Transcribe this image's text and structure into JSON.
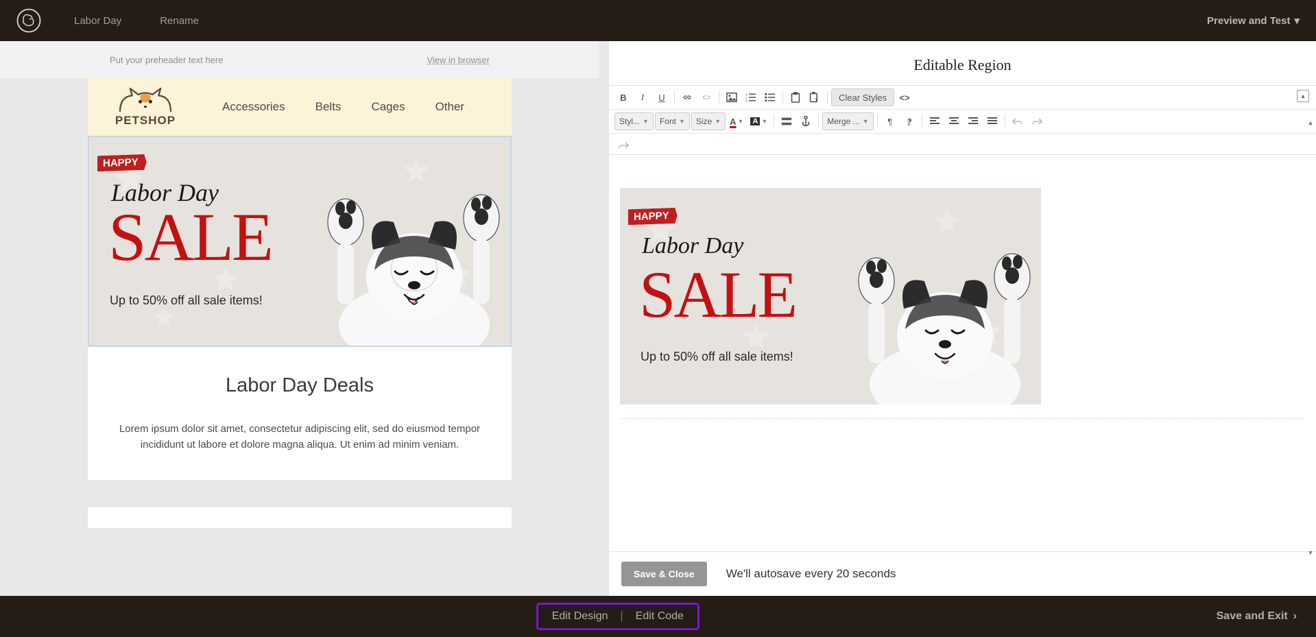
{
  "topbar": {
    "campaign_name": "Labor Day",
    "rename": "Rename",
    "preview_test": "Preview and Test"
  },
  "preview": {
    "preheader_placeholder": "Put your preheader text here",
    "view_in_browser": "View in browser",
    "brand_name": "PETSHOP",
    "nav": {
      "a": "Accessories",
      "b": "Belts",
      "c": "Cages",
      "d": "Other"
    },
    "hero": {
      "ribbon": "HAPPY",
      "cursive": "Labor Day",
      "sale": "SALE",
      "sub": "Up to 50% off all sale items!"
    },
    "deals_heading": "Labor Day Deals",
    "deals_body": "Lorem ipsum dolor sit amet, consectetur adipiscing elit, sed do eiusmod tempor incididunt ut labore et dolore magna aliqua. Ut enim ad minim veniam."
  },
  "editor": {
    "region_title": "Editable Region",
    "toolbar": {
      "clear_styles": "Clear Styles",
      "style": "Styl...",
      "font": "Font",
      "size": "Size",
      "merge": "Merge ..."
    },
    "save_close": "Save & Close",
    "autosave": "We'll autosave every 20 seconds"
  },
  "bottombar": {
    "edit_design": "Edit Design",
    "edit_code": "Edit Code",
    "save_exit": "Save and Exit"
  }
}
